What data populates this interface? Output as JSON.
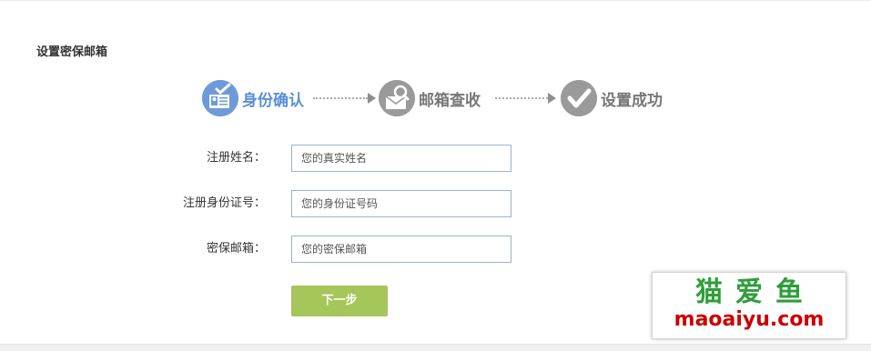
{
  "page": {
    "title": "设置密保邮箱"
  },
  "steps": [
    {
      "label": "身份确认",
      "icon": "id-card-icon",
      "state": "active",
      "color": "#5a8fd6"
    },
    {
      "label": "邮箱查收",
      "icon": "mail-search-icon",
      "state": "inactive",
      "color": "#999999"
    },
    {
      "label": "设置成功",
      "icon": "check-icon",
      "state": "inactive",
      "color": "#999999"
    }
  ],
  "form": {
    "name": {
      "label": "注册姓名：",
      "placeholder": "您的真实姓名",
      "value": ""
    },
    "id_number": {
      "label": "注册身份证号：",
      "placeholder": "您的身份证号码",
      "value": ""
    },
    "email": {
      "label": "密保邮箱：",
      "placeholder": "您的密保邮箱",
      "value": ""
    }
  },
  "actions": {
    "next_label": "下一步"
  },
  "watermark": {
    "chinese": "猫爱鱼",
    "domain": "maoaiyu.com"
  },
  "colors": {
    "accent": "#5a8fd6",
    "button": "#a4c65a",
    "watermark_green": "#2f9e3a",
    "watermark_red": "#cc0000"
  }
}
